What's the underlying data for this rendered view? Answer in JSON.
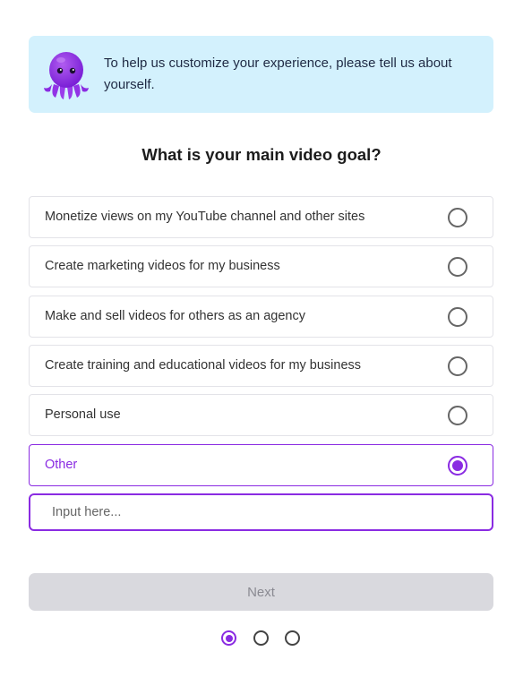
{
  "banner": {
    "text": "To help us customize your experience, please tell us about yourself.",
    "mascot_icon": "octopus-icon"
  },
  "question": "What is your main video goal?",
  "options": [
    {
      "label": "Monetize views on my YouTube channel and other sites",
      "selected": false
    },
    {
      "label": "Create marketing videos for my business",
      "selected": false
    },
    {
      "label": "Make and sell videos for others as an agency",
      "selected": false
    },
    {
      "label": "Create training and educational videos for my business",
      "selected": false
    },
    {
      "label": "Personal use",
      "selected": false
    },
    {
      "label": "Other",
      "selected": true
    }
  ],
  "other_input": {
    "placeholder": "Input here...",
    "value": ""
  },
  "next_button": {
    "label": "Next",
    "disabled": true
  },
  "steps": {
    "current": 1,
    "total": 3
  },
  "colors": {
    "accent": "#8a2be2",
    "banner_bg": "#d3f1fd",
    "button_disabled": "#d9d9de"
  }
}
